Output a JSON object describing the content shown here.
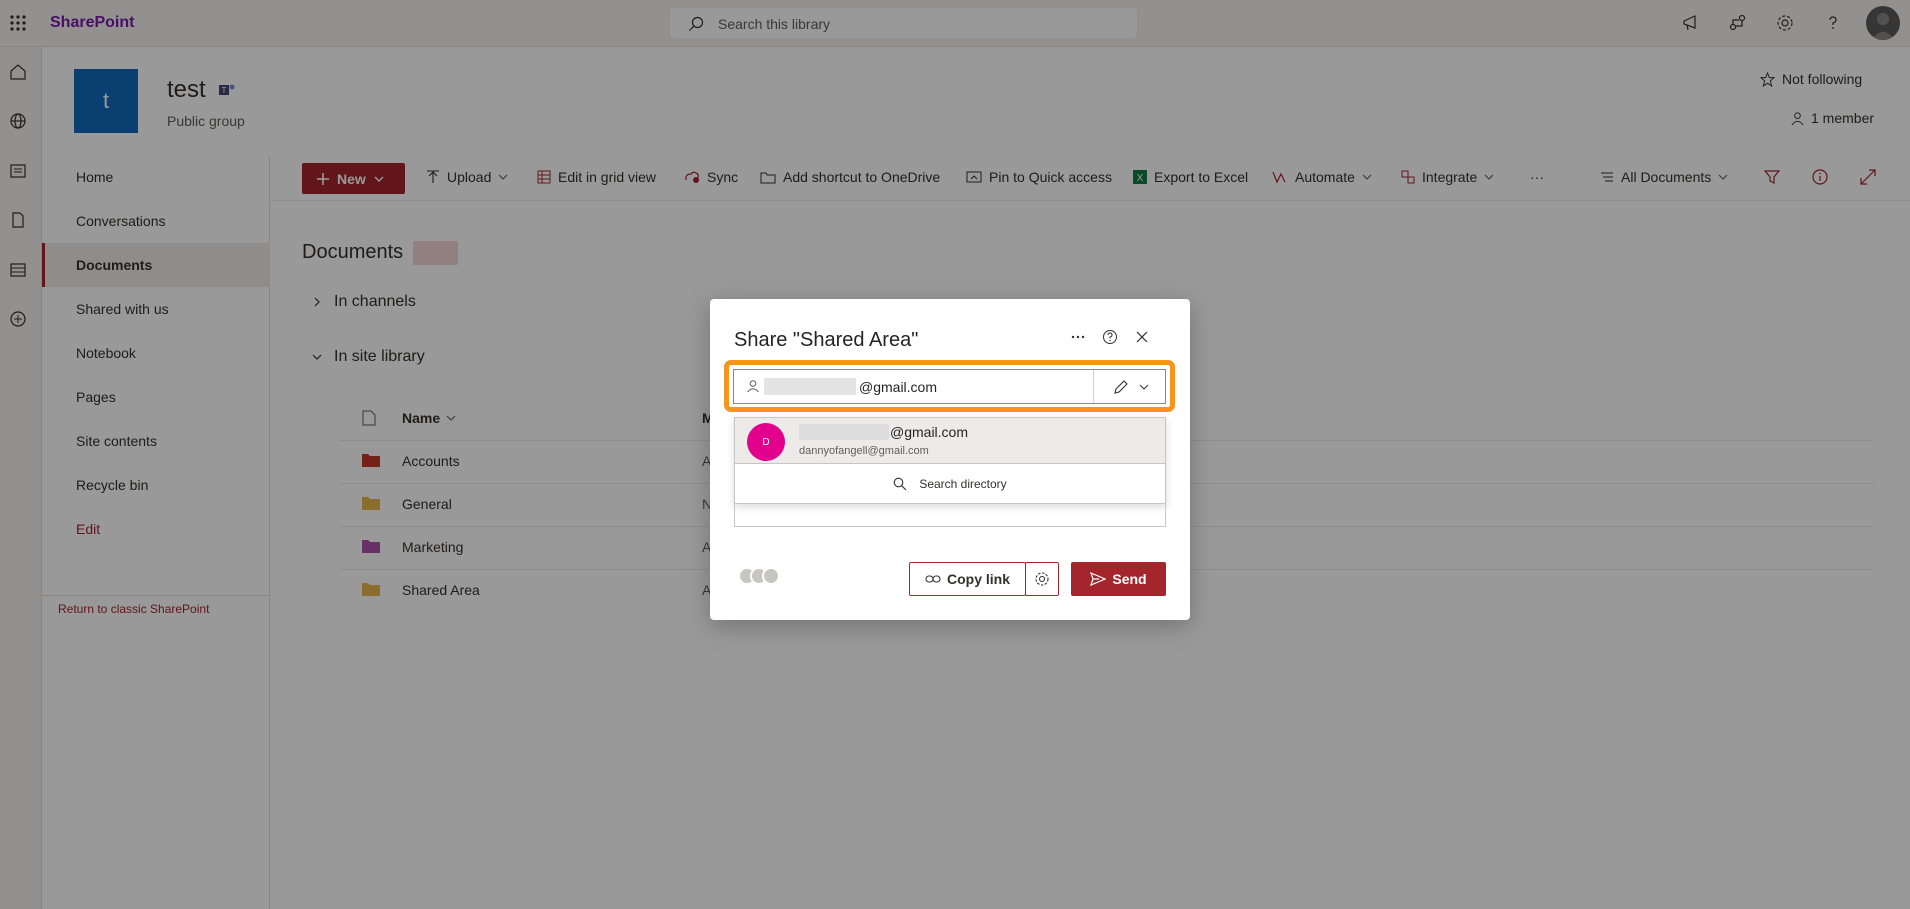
{
  "suitebar": {
    "brand": "SharePoint",
    "search_placeholder": "Search this library",
    "icons": [
      "waffle-icon",
      "megaphone-icon",
      "network-icon",
      "gear-icon",
      "help-icon",
      "user-avatar"
    ]
  },
  "rail": {
    "icons": [
      "home-icon",
      "globe-icon",
      "news-icon",
      "file-icon",
      "list-icon",
      "add-icon"
    ]
  },
  "site": {
    "logo_letter": "t",
    "title": "test",
    "subtitle": "Public group",
    "follow_label": "Not following",
    "members_label": "1 member"
  },
  "leftnav": {
    "items": [
      {
        "label": "Home"
      },
      {
        "label": "Conversations"
      },
      {
        "label": "Documents"
      },
      {
        "label": "Shared with us"
      },
      {
        "label": "Notebook"
      },
      {
        "label": "Pages"
      },
      {
        "label": "Site contents"
      },
      {
        "label": "Recycle bin"
      },
      {
        "label": "Edit"
      }
    ],
    "classic_link": "Return to classic SharePoint"
  },
  "commandbar": {
    "new": "New",
    "upload": "Upload",
    "grid": "Edit in grid view",
    "sync": "Sync",
    "shortcut": "Add shortcut to OneDrive",
    "pin": "Pin to Quick access",
    "export": "Export to Excel",
    "automate": "Automate",
    "integrate": "Integrate",
    "more": "···",
    "view": "All Documents"
  },
  "library": {
    "title": "Documents",
    "sections": [
      "In channels",
      "In site library"
    ],
    "columns": {
      "name": "Name",
      "modified": "M"
    },
    "rows": [
      {
        "name": "Accounts",
        "mod": "A",
        "color": "#c0392b"
      },
      {
        "name": "General",
        "mod": "N",
        "color": "#e8b84b"
      },
      {
        "name": "Marketing",
        "mod": "A",
        "color": "#b04fb0"
      },
      {
        "name": "Shared Area",
        "mod": "A",
        "color": "#e8b84b"
      }
    ]
  },
  "dialog": {
    "title": "Share \"Shared Area\"",
    "to_value": "@gmail.com",
    "suggestion": {
      "initial": "D",
      "main": "@gmail.com",
      "sub": "dannyofangell@gmail.com"
    },
    "search_directory": "Search directory",
    "copy_link": "Copy link",
    "send": "Send",
    "colors": {
      "accent": "#a4262c",
      "highlight": "#f7941d",
      "avatar": "#e3008c"
    }
  }
}
